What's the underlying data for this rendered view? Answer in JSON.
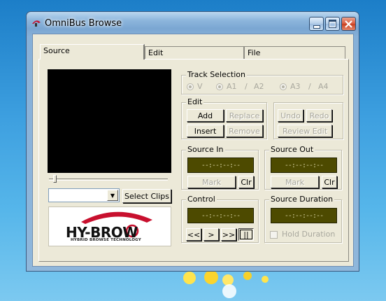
{
  "window": {
    "title": "OmniBus Browse"
  },
  "tabs": [
    {
      "label": "Source",
      "active": true
    },
    {
      "label": "Edit",
      "active": false
    },
    {
      "label": "File",
      "active": false
    }
  ],
  "clips": {
    "combo_value": "",
    "select_label": "Select Clips"
  },
  "logo": {
    "brand": "HY-BROW",
    "tagline": "HYBRID BROWSE TECHNOLOGY"
  },
  "track_selection": {
    "label": "Track Selection",
    "options": [
      "V",
      "A1",
      "A2",
      "A3",
      "A4"
    ],
    "separator": "/"
  },
  "edit": {
    "label": "Edit",
    "add": "Add",
    "replace": "Replace",
    "insert": "Insert",
    "remove": "Remove",
    "undo": "Undo",
    "redo": "Redo",
    "review_edit": "Review Edit"
  },
  "source_in": {
    "label": "Source In",
    "timecode": "--:--:--:--",
    "mark": "Mark",
    "clear": "Clr"
  },
  "source_out": {
    "label": "Source Out",
    "timecode": "--:--:--:--",
    "mark": "Mark",
    "clear": "Clr"
  },
  "control": {
    "label": "Control",
    "timecode": "--:--:--:--",
    "rewind": "<<",
    "play": ">",
    "fast_forward": ">>",
    "pause": "||"
  },
  "source_duration": {
    "label": "Source Duration",
    "timecode": "--:--:--:--",
    "hold": "Hold Duration"
  },
  "colors": {
    "lcd_bg": "#4d4a00",
    "panel": "#ece9d8",
    "disabled_text": "#a9a89e",
    "logo_red": "#c8102e"
  }
}
